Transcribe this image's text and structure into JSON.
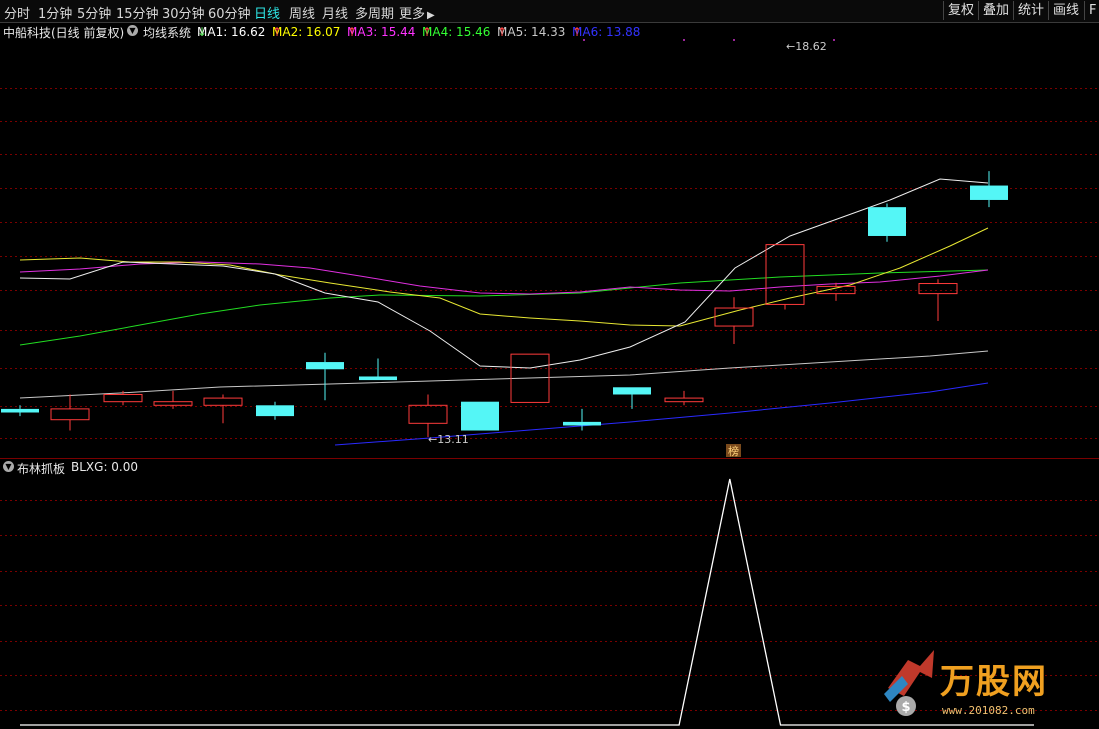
{
  "toolbar": {
    "periods": [
      "分时",
      "1分钟",
      "5分钟",
      "15分钟",
      "30分钟",
      "60分钟",
      "日线",
      "周线",
      "月线",
      "多周期",
      "更多"
    ],
    "active_period": "日线",
    "right_buttons": [
      "复权",
      "叠加",
      "统计",
      "画线",
      "F"
    ]
  },
  "main_info": {
    "stock": "中船科技(日线 前复权)",
    "indicator": "均线系统",
    "ma": [
      {
        "label": "MA1: 16.62",
        "arrow": "↓",
        "color": "#ffffff"
      },
      {
        "label": "MA2: 16.07",
        "arrow": "↑",
        "color": "#ffff00"
      },
      {
        "label": "MA3: 15.44",
        "arrow": "↑",
        "color": "#ff33ff"
      },
      {
        "label": "MA4: 15.46",
        "arrow": "↑",
        "color": "#33ff33"
      },
      {
        "label": "MA5: 14.33",
        "arrow": "↑",
        "color": "#c8c8c8"
      },
      {
        "label": "MA6: 13.88",
        "arrow": "↑",
        "color": "#3333ff"
      }
    ]
  },
  "annotations": {
    "high": "18.62",
    "low": "13.11",
    "badge": "榜"
  },
  "sub_info": {
    "indicator": "布林抓板",
    "value": "BLXG: 0.00"
  },
  "logo": {
    "text": "万股网",
    "url": "www.201082.com"
  },
  "colors": {
    "up": "#ff3b3b",
    "down": "#54f6f6",
    "grid": "#7a0000"
  },
  "chart_data": {
    "type": "candlestick",
    "series": [
      {
        "open": 13.5,
        "close": 13.45,
        "high": 13.55,
        "low": 13.4
      },
      {
        "open": 13.35,
        "close": 13.5,
        "high": 13.7,
        "low": 13.2
      },
      {
        "open": 13.6,
        "close": 13.7,
        "high": 13.75,
        "low": 13.55
      },
      {
        "open": 13.55,
        "close": 13.6,
        "high": 13.75,
        "low": 13.5
      },
      {
        "open": 13.55,
        "close": 13.65,
        "high": 13.7,
        "low": 13.3
      },
      {
        "open": 13.55,
        "close": 13.4,
        "high": 13.6,
        "low": 13.35
      },
      {
        "open": 14.15,
        "close": 14.05,
        "high": 14.28,
        "low": 13.62
      },
      {
        "open": 13.95,
        "close": 13.9,
        "high": 14.2,
        "low": 13.9
      },
      {
        "open": 13.3,
        "close": 13.55,
        "high": 13.7,
        "low": 13.11
      },
      {
        "open": 13.6,
        "close": 13.2,
        "high": 13.6,
        "low": 13.2
      },
      {
        "open": 13.59,
        "close": 14.26,
        "high": 14.26,
        "low": 13.59
      },
      {
        "open": 13.32,
        "close": 13.27,
        "high": 13.5,
        "low": 13.2
      },
      {
        "open": 13.8,
        "close": 13.7,
        "high": 13.8,
        "low": 13.5
      },
      {
        "open": 13.6,
        "close": 13.65,
        "high": 13.75,
        "low": 13.55
      },
      {
        "open": 14.65,
        "close": 14.9,
        "high": 15.05,
        "low": 14.4
      },
      {
        "open": 14.95,
        "close": 15.78,
        "high": 15.78,
        "low": 14.88
      },
      {
        "open": 15.1,
        "close": 15.2,
        "high": 15.25,
        "low": 15.0
      },
      {
        "open": 16.3,
        "close": 15.9,
        "high": 16.35,
        "low": 15.82
      },
      {
        "open": 15.1,
        "close": 15.24,
        "high": 15.3,
        "low": 14.72
      },
      {
        "open": 16.6,
        "close": 16.4,
        "high": 16.8,
        "low": 16.3
      }
    ],
    "subchart": {
      "name": "BLXG",
      "values": [
        0,
        0,
        0,
        0,
        0,
        0,
        0,
        0,
        0,
        0,
        0,
        0,
        0,
        0,
        1,
        0,
        0,
        0,
        0,
        0,
        0
      ]
    },
    "grid": true
  }
}
